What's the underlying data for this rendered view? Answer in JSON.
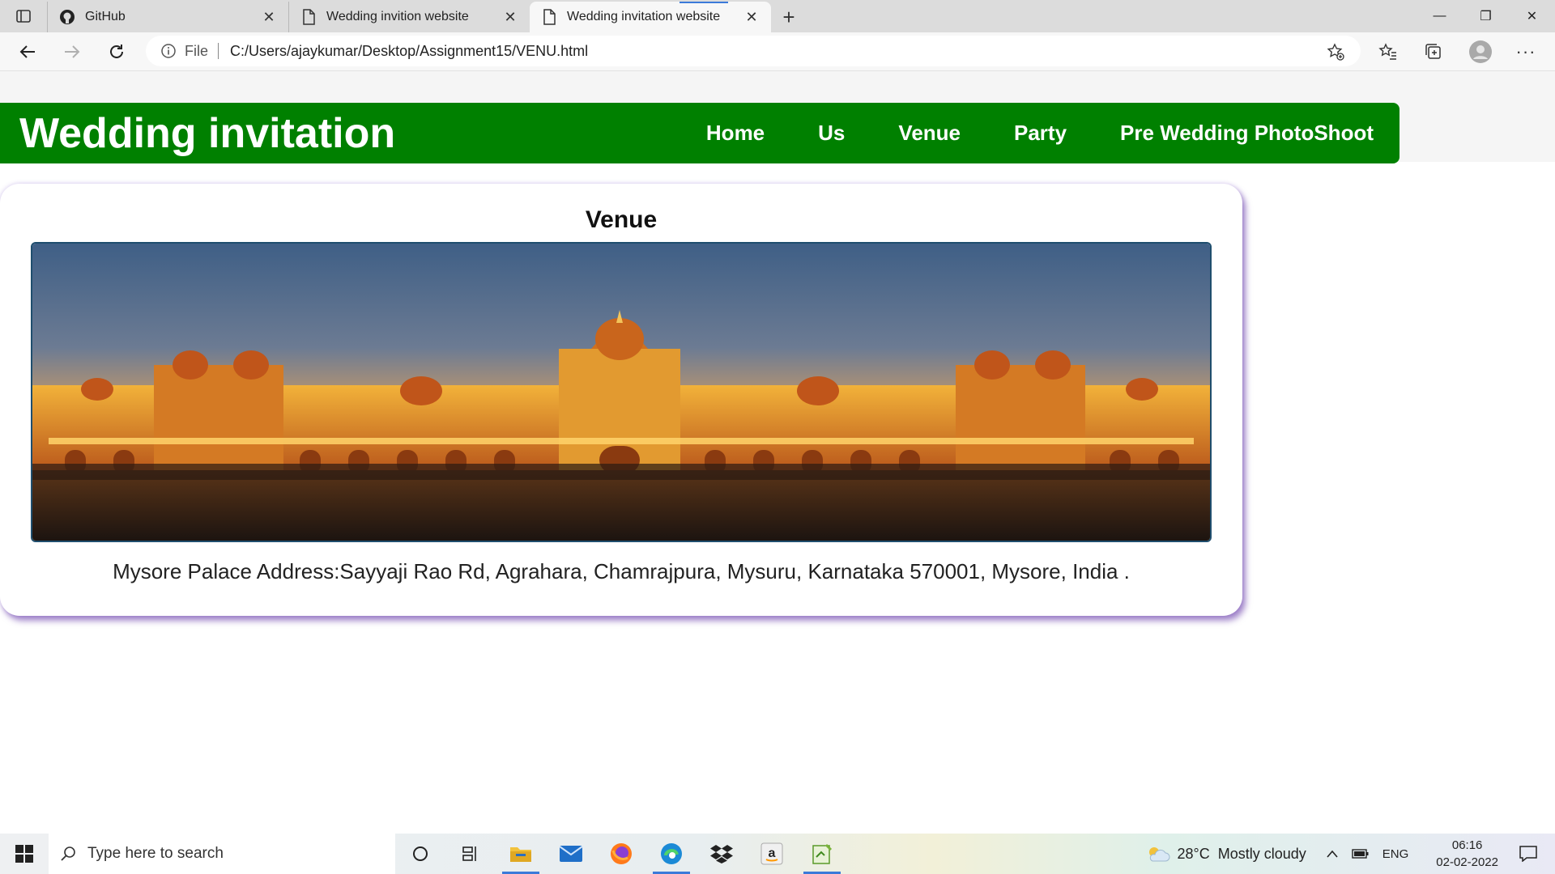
{
  "browser": {
    "tabs": [
      {
        "title": "GitHub",
        "icon": "github-icon",
        "active": false
      },
      {
        "title": "Wedding invition website",
        "icon": "page-icon",
        "active": false
      },
      {
        "title": "Wedding invitation website",
        "icon": "page-icon",
        "active": true
      }
    ],
    "address": {
      "scheme": "File",
      "url": "C:/Users/ajaykumar/Desktop/Assignment15/VENU.html"
    }
  },
  "site": {
    "brand": "Wedding invitation",
    "nav": [
      "Home",
      "Us",
      "Venue",
      "Party",
      "Pre Wedding PhotoShoot"
    ],
    "nav_color": "#008000"
  },
  "venue": {
    "heading": "Venue",
    "address": "Mysore Palace Address:Sayyaji Rao Rd, Agrahara, Chamrajpura, Mysuru, Karnataka 570001, Mysore, India ."
  },
  "taskbar": {
    "search_placeholder": "Type here to search",
    "weather": "28°C  Mostly cloudy",
    "language": "ENG",
    "time": "06:16",
    "date": "02-02-2022"
  }
}
